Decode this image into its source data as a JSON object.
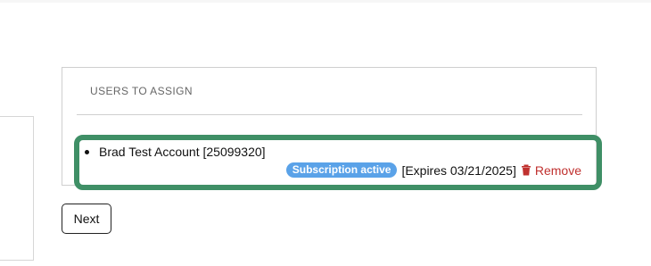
{
  "card": {
    "title": "USERS TO ASSIGN"
  },
  "users": [
    {
      "name": "Brad Test Account [25099320]",
      "status_badge": "Subscription active",
      "expires": "[Expires 03/21/2025]",
      "remove_label": "Remove"
    }
  ],
  "actions": {
    "next_label": "Next"
  },
  "colors": {
    "highlight_border": "#3f8f66",
    "badge_bg": "#5aa2e8",
    "remove_text": "#c0312f"
  },
  "icons": {
    "remove": "trash-icon"
  }
}
